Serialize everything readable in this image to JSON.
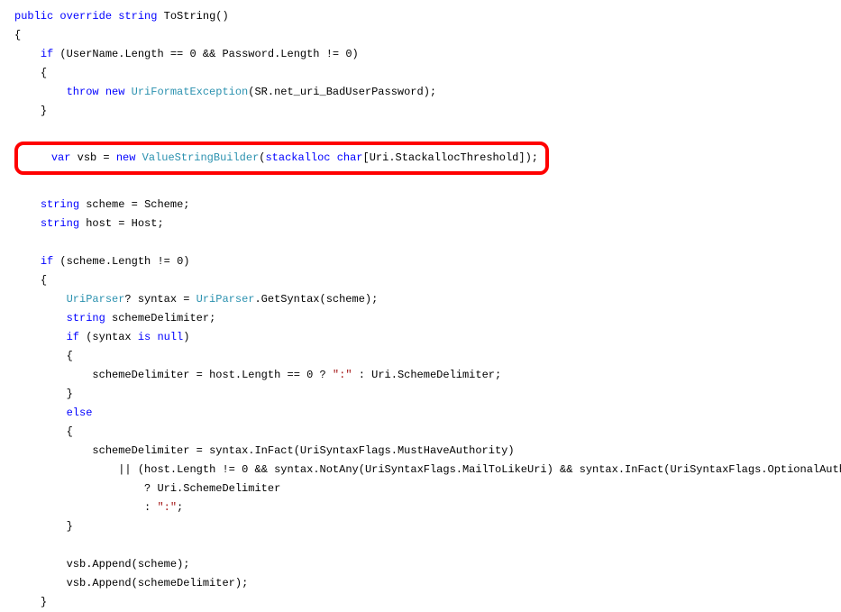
{
  "kw": {
    "public": "public",
    "override": "override",
    "string_t": "string",
    "if": "if",
    "throw": "throw",
    "new": "new",
    "var": "var",
    "stackalloc": "stackalloc",
    "char": "char",
    "is": "is",
    "null": "null",
    "else": "else"
  },
  "type": {
    "UriFormatException": "UriFormatException",
    "ValueStringBuilder": "ValueStringBuilder",
    "UriParser": "UriParser"
  },
  "id": {
    "ToString": "ToString",
    "UserName": "UserName",
    "Length": "Length",
    "Password": "Password",
    "SR": "SR",
    "net_uri_BadUserPassword": "net_uri_BadUserPassword",
    "vsb": "vsb",
    "Uri": "Uri",
    "StackallocThreshold": "StackallocThreshold",
    "scheme": "scheme",
    "Scheme": "Scheme",
    "host": "host",
    "Host": "Host",
    "syntax": "syntax",
    "GetSyntax": "GetSyntax",
    "schemeDelimiter": "schemeDelimiter",
    "SchemeDelimiter": "SchemeDelimiter",
    "InFact": "InFact",
    "UriSyntaxFlags": "UriSyntaxFlags",
    "MustHaveAuthority": "MustHaveAuthority",
    "NotAny": "NotAny",
    "MailToLikeUri": "MailToLikeUri",
    "OptionalAuthority": "OptionalAuthority",
    "Append": "Append"
  },
  "op": {
    "eq0": " == 0",
    "neq0": " != 0",
    "and": " && ",
    "or": " || ",
    "q": " ? ",
    "colon": " : ",
    "assign": " = ",
    "dot": ".",
    "semi": ";",
    "qmark": "?",
    "open_p": "(",
    "close_p": ")",
    "open_b": "{",
    "close_b": "}",
    "open_sq": "[",
    "close_sq": "]"
  },
  "str": {
    "colon": "\":\""
  }
}
